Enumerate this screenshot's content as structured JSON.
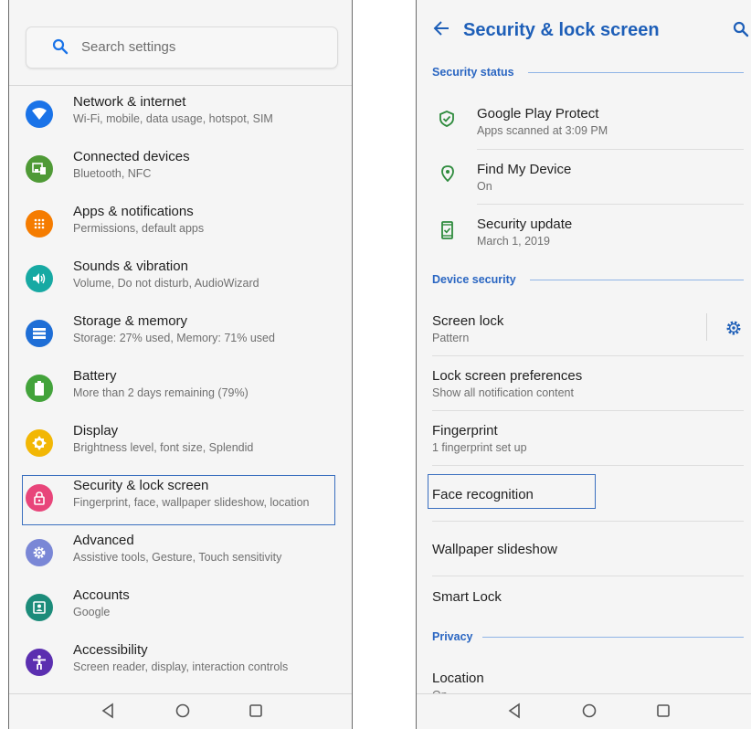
{
  "left": {
    "search_placeholder": "Search settings",
    "items": [
      {
        "title": "Network & internet",
        "subtitle": "Wi-Fi, mobile, data usage, hotspot, SIM",
        "icon": "wifi-icon",
        "color": "#1a73e8"
      },
      {
        "title": "Connected devices",
        "subtitle": "Bluetooth, NFC",
        "icon": "devices-icon",
        "color": "#4f9a36"
      },
      {
        "title": "Apps & notifications",
        "subtitle": "Permissions, default apps",
        "icon": "apps-icon",
        "color": "#f57c00"
      },
      {
        "title": "Sounds & vibration",
        "subtitle": "Volume, Do not disturb, AudioWizard",
        "icon": "volume-icon",
        "color": "#17a9a3"
      },
      {
        "title": "Storage & memory",
        "subtitle": "Storage: 27% used, Memory: 71% used",
        "icon": "storage-icon",
        "color": "#1e6ed6"
      },
      {
        "title": "Battery",
        "subtitle": "More than 2 days remaining (79%)",
        "icon": "battery-icon",
        "color": "#43a33b"
      },
      {
        "title": "Display",
        "subtitle": "Brightness level, font size, Splendid",
        "icon": "brightness-icon",
        "color": "#f2b705"
      },
      {
        "title": "Security & lock screen",
        "subtitle": "Fingerprint, face, wallpaper slideshow, location",
        "icon": "lock-icon",
        "color": "#e8457a"
      },
      {
        "title": "Advanced",
        "subtitle": "Assistive tools, Gesture, Touch sensitivity",
        "icon": "gear-icon",
        "color": "#7a87d6"
      },
      {
        "title": "Accounts",
        "subtitle": "Google",
        "icon": "account-icon",
        "color": "#1c8c7a"
      },
      {
        "title": "Accessibility",
        "subtitle": "Screen reader, display, interaction controls",
        "icon": "accessibility-icon",
        "color": "#5b2fb0"
      }
    ]
  },
  "right": {
    "title": "Security & lock screen",
    "sections": {
      "status": "Security status",
      "device": "Device security",
      "privacy": "Privacy"
    },
    "status_items": [
      {
        "title": "Google Play Protect",
        "subtitle": "Apps scanned at 3:09 PM",
        "icon": "shield-icon"
      },
      {
        "title": "Find My Device",
        "subtitle": "On",
        "icon": "location-pin-icon"
      },
      {
        "title": "Security update",
        "subtitle": "March 1, 2019",
        "icon": "phone-check-icon"
      }
    ],
    "device_items": [
      {
        "title": "Screen lock",
        "subtitle": "Pattern"
      },
      {
        "title": "Lock screen preferences",
        "subtitle": "Show all notification content"
      },
      {
        "title": "Fingerprint",
        "subtitle": "1 fingerprint set up"
      },
      {
        "title": "Face recognition"
      },
      {
        "title": "Wallpaper slideshow"
      },
      {
        "title": "Smart Lock"
      }
    ],
    "privacy_items": [
      {
        "title": "Location",
        "subtitle": "On"
      }
    ]
  },
  "colors": {
    "accent": "#1e5fb8",
    "section": "#2a66c2",
    "status_icon": "#2e8b3d",
    "highlight": "#3a6fbf"
  }
}
